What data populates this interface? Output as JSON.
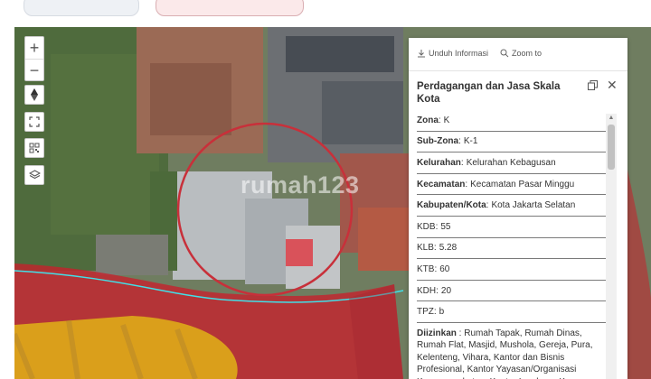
{
  "map": {
    "controls": {
      "zoom_in": "+",
      "zoom_out": "−",
      "compass_icon": "compass-icon",
      "fullscreen_icon": "fullscreen-icon",
      "qr_icon": "qr-code-icon",
      "layers_icon": "layers-icon"
    },
    "watermark": "rumah123",
    "colors": {
      "red_zone": "#c8202c",
      "yellow_zone": "#e0b316",
      "boundary": "#40e0e8",
      "circle": "#c8303a"
    }
  },
  "popup": {
    "actions": {
      "download": "Unduh Informasi",
      "zoom_to": "Zoom to"
    },
    "title": "Perdagangan dan Jasa Skala Kota",
    "rows": [
      {
        "key": "Zona",
        "value": "K"
      },
      {
        "key": "Sub-Zona",
        "value": "K-1"
      },
      {
        "key": "Kelurahan",
        "value": "Kelurahan Kebagusan"
      },
      {
        "key": "Kecamatan",
        "value": "Kecamatan Pasar Minggu"
      },
      {
        "key": "Kabupaten/Kota",
        "value": "Kota Jakarta Selatan"
      },
      {
        "key": "KDB",
        "value": "55"
      },
      {
        "key": "KLB",
        "value": "5.28"
      },
      {
        "key": "KTB",
        "value": "60"
      },
      {
        "key": "KDH",
        "value": "20"
      },
      {
        "key": "TPZ",
        "value": "b"
      }
    ],
    "diizinkan": {
      "key": "Diizinkan",
      "value": "Rumah Tapak, Rumah Dinas, Rumah Flat, Masjid, Mushola, Gereja, Pura, Kelenteng, Vihara, Kantor dan Bisnis Profesional, Kantor Yayasan/Organisasi Kemasyarakatan, Kantor Lembaga Keuangan,"
    }
  }
}
